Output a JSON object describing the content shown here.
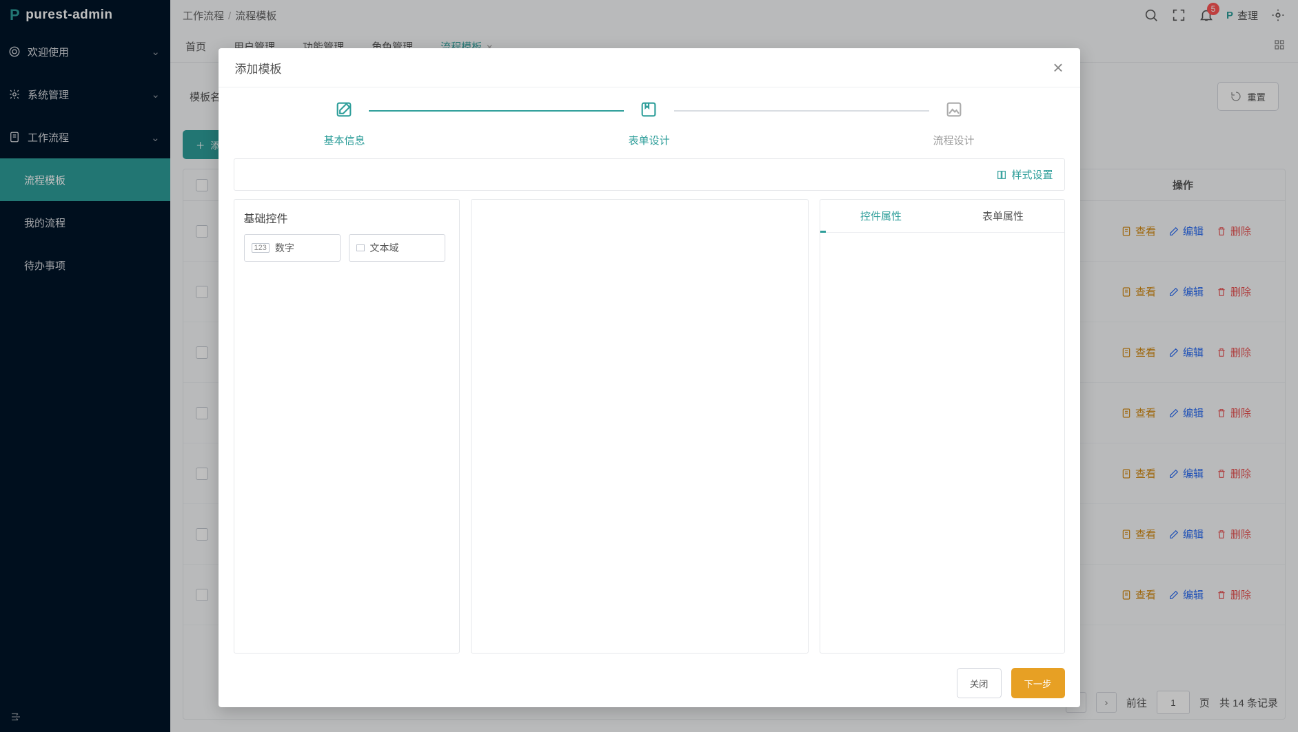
{
  "app": {
    "name": "purest-admin"
  },
  "breadcrumb": {
    "a": "工作流程",
    "b": "流程模板"
  },
  "topbar": {
    "notif_count": "5",
    "user_name": "查理"
  },
  "sidebar": {
    "welcome": "欢迎使用",
    "system": "系统管理",
    "workflow": "工作流程",
    "sub_template": "流程模板",
    "sub_mine": "我的流程",
    "sub_todo": "待办事项"
  },
  "tabs": {
    "home": "首页",
    "user": "用户管理",
    "func": "功能管理",
    "role": "角色管理",
    "tmpl": "流程模板"
  },
  "query": {
    "label": "模板名称",
    "reset": "重置",
    "add": "添加"
  },
  "table": {
    "op_header": "操作",
    "view": "查看",
    "edit": "编辑",
    "del": "删除",
    "rows": 7
  },
  "pager": {
    "goto": "前往",
    "page": "1",
    "page_suffix": "页",
    "total_prefix": "共",
    "total": "14",
    "total_suffix": "条记录"
  },
  "modal": {
    "title": "添加模板",
    "steps": {
      "s1": "基本信息",
      "s2": "表单设计",
      "s3": "流程设计"
    },
    "style_link": "样式设置",
    "palette_header": "基础控件",
    "ctl_number": "数字",
    "ctl_textarea": "文本域",
    "tab_ctl": "控件属性",
    "tab_form": "表单属性",
    "btn_close": "关闭",
    "btn_next": "下一步"
  }
}
